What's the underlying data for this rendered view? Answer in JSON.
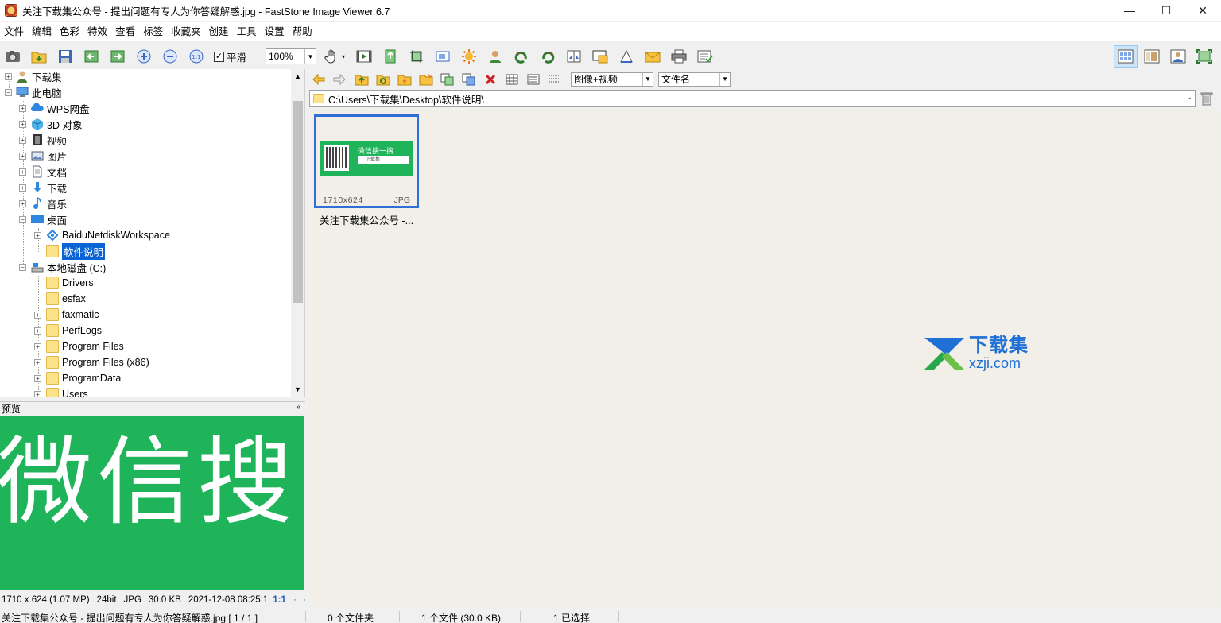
{
  "window": {
    "title": "关注下载集公众号  -  提出问题有专人为你答疑解惑.jpg  -  FastStone Image Viewer 6.7",
    "minimize": "—",
    "maximize": "☐",
    "close": "✕"
  },
  "menu": [
    "文件",
    "编辑",
    "色彩",
    "特效",
    "查看",
    "标签",
    "收藏夹",
    "创建",
    "工具",
    "设置",
    "帮助"
  ],
  "toolbar": {
    "smooth_label": "平滑",
    "smooth_checked": "✓",
    "zoom_value": "100%",
    "zoom_dropdown": "▼",
    "hand_dropdown": "▾"
  },
  "tree": [
    {
      "label": "下载集",
      "icon": "user-icon",
      "level": 0
    },
    {
      "label": "此电脑",
      "icon": "computer-icon",
      "level": 0
    },
    {
      "label": "WPS网盘",
      "icon": "cloud-icon",
      "level": 1
    },
    {
      "label": "3D 对象",
      "icon": "cube-icon",
      "level": 1
    },
    {
      "label": "视频",
      "icon": "film-icon",
      "level": 1
    },
    {
      "label": "图片",
      "icon": "picture-icon",
      "level": 1
    },
    {
      "label": "文档",
      "icon": "document-icon",
      "level": 1
    },
    {
      "label": "下载",
      "icon": "download-icon",
      "level": 1
    },
    {
      "label": "音乐",
      "icon": "music-icon",
      "level": 1
    },
    {
      "label": "桌面",
      "icon": "desktop-icon",
      "level": 1
    },
    {
      "label": "BaiduNetdiskWorkspace",
      "icon": "baidu-icon",
      "level": 2
    },
    {
      "label": "软件说明",
      "icon": "folder-icon",
      "level": 2
    },
    {
      "label": "本地磁盘 (C:)",
      "icon": "drive-icon",
      "level": 1
    },
    {
      "label": "Drivers",
      "icon": "folder-icon",
      "level": 2
    },
    {
      "label": "esfax",
      "icon": "folder-icon",
      "level": 2
    },
    {
      "label": "faxmatic",
      "icon": "folder-icon",
      "level": 2
    },
    {
      "label": "PerfLogs",
      "icon": "folder-icon",
      "level": 2
    },
    {
      "label": "Program Files",
      "icon": "folder-icon",
      "level": 2
    },
    {
      "label": "Program Files (x86)",
      "icon": "folder-icon",
      "level": 2
    },
    {
      "label": "ProgramData",
      "icon": "folder-icon",
      "level": 2
    },
    {
      "label": "Users",
      "icon": "folder-icon",
      "level": 2
    }
  ],
  "preview": {
    "header": "预览",
    "collapse": "»",
    "image_text": "微信搜",
    "info": {
      "dimensions": "1710 x 624 (1.07 MP)",
      "bitdepth": "24bit",
      "format": "JPG",
      "size": "30.0 KB",
      "date": "2021-12-08 08:25:1",
      "ratio": "1:1"
    }
  },
  "browser": {
    "filter": "图像+视频",
    "sort": "文件名",
    "path": "C:\\Users\\下载集\\Desktop\\软件说明\\"
  },
  "thumbnail": {
    "dimensions": "1710x624",
    "format": "JPG",
    "caption": "关注下载集公众号 -...",
    "inner_title": "微信搜一搜",
    "inner_search": "下载集"
  },
  "watermark": {
    "cn": "下载集",
    "en": "xzji.com"
  },
  "status": {
    "file": "关注下载集公众号 - 提出问题有专人为你答疑解惑.jpg [ 1 / 1 ]",
    "folders": "0 个文件夹",
    "files": "1 个文件 (30.0 KB)",
    "selected": "1 已选择"
  },
  "colors": {
    "preview_green": "#1fb45a",
    "selection_blue": "#0a64d6",
    "thumb_border": "#2f6fd6",
    "watermark_blue": "#1e6fd6"
  }
}
